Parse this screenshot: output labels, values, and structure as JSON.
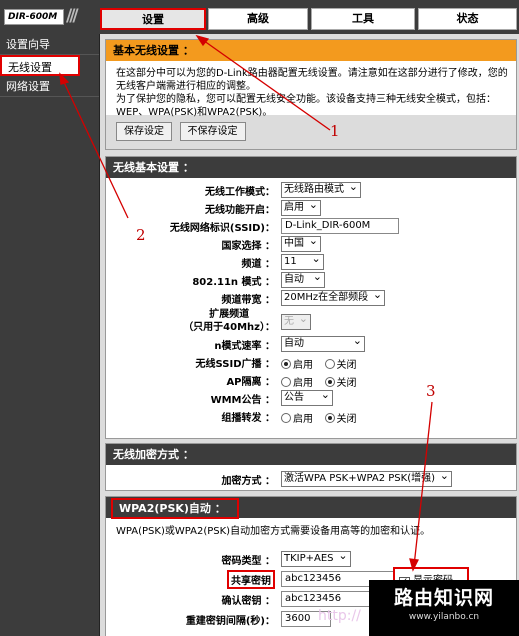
{
  "header": {
    "model": "DIR-600M",
    "tabs": [
      {
        "label": "设置",
        "active": true
      },
      {
        "label": "高级",
        "active": false
      },
      {
        "label": "工具",
        "active": false
      },
      {
        "label": "状态",
        "active": false
      }
    ]
  },
  "sidebar": {
    "items": [
      {
        "label": "设置向导"
      },
      {
        "label": "无线设置"
      },
      {
        "label": "网络设置"
      }
    ]
  },
  "basic_panel": {
    "title": "基本无线设置 ：",
    "intro_line1": "在这部分中可以为您的D-Link路由器配置无线设置。请注意如在这部分进行了修改，您的无线客户端需进行相应的调整。",
    "intro_line2": "为了保护您的隐私，您可以配置无线安全功能。该设备支持三种无线安全模式，包括：WEP、WPA(PSK)和WPA2(PSK)。",
    "save_label": "保存设定",
    "nosave_label": "不保存设定"
  },
  "wireless_basic": {
    "title": "无线基本设置 ：",
    "mode_label": "无线工作模式：",
    "mode_value": "无线路由模式",
    "enable_label": "无线功能开启：",
    "enable_value": "启用",
    "ssid_label": "无线网络标识(SSID)：",
    "ssid_value": "D-Link_DIR-600M",
    "country_label": "国家选择 ：",
    "country_value": "中国",
    "channel_label": "频道 ：",
    "channel_value": "11",
    "n_mode_label": "802.11n 模式 ：",
    "n_mode_value": "自动",
    "bandwidth_label": "频道带宽 ：",
    "bandwidth_value": "20MHz在全部频段",
    "ext_label_1": "扩展频道",
    "ext_label_2": "（只用于40Mhz）：",
    "ext_value": "无",
    "rate_label": "n模式速率 ：",
    "rate_value": "自动",
    "broadcast_label": "无线SSID广播 ：",
    "ap_iso_label": "AP隔离 ：",
    "wmm_label": "WMM公告 ：",
    "wmm_value": "公告",
    "multicast_label": "组播转发 ：",
    "opt_enable": "启用",
    "opt_disable": "关闭"
  },
  "encryption": {
    "title": "无线加密方式 ：",
    "method_label": "加密方式 ：",
    "method_value": "激活WPA PSK+WPA2 PSK(增强)"
  },
  "wpa2": {
    "title": "WPA2(PSK)自动 ：",
    "desc": "WPA(PSK)或WPA2(PSK)自动加密方式需要设备用高等的加密和认证。",
    "cipher_label": "密码类型 ：",
    "cipher_value": "TKIP+AES",
    "key_label": "共享密钥",
    "key_value": "abc123456",
    "confirm_label": "确认密钥 ：",
    "confirm_value": "abc123456",
    "rekey_label": "重建密钥间隔(秒)：",
    "rekey_value": "3600",
    "show_pw_label": "显示密码"
  },
  "annotations": {
    "n1": "1",
    "n2": "2",
    "n3": "3"
  },
  "watermark": {
    "title": "路由知识网",
    "url": "www.yilanbo.cn",
    "faint": "http://"
  },
  "colors": {
    "accent_red": "#e00000",
    "orange": "#f39a1e",
    "dark": "#3c3c3c"
  }
}
